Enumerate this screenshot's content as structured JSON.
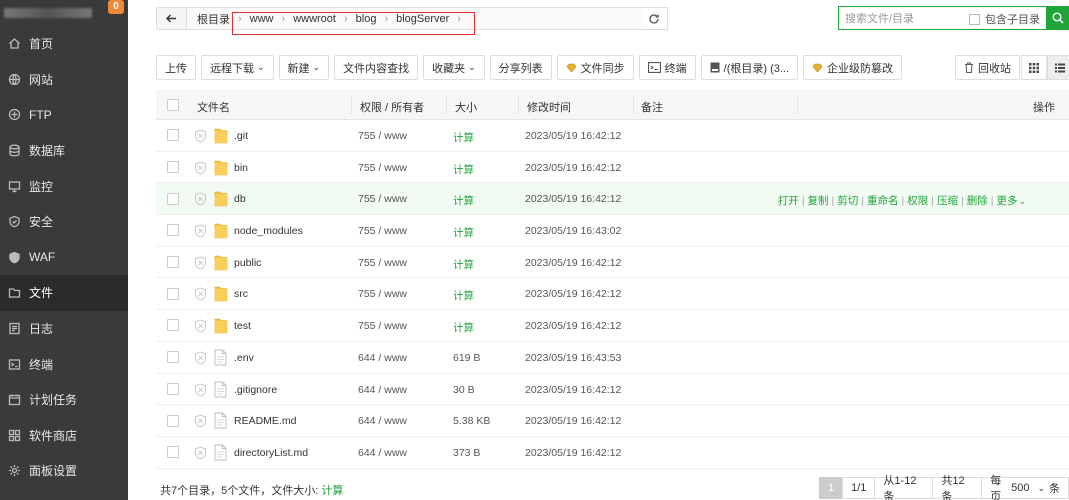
{
  "sidebar": {
    "badge": "0",
    "items": [
      {
        "label": "首页",
        "icon": "home-icon"
      },
      {
        "label": "网站",
        "icon": "globe-icon"
      },
      {
        "label": "FTP",
        "icon": "ftp-icon"
      },
      {
        "label": "数据库",
        "icon": "database-icon"
      },
      {
        "label": "监控",
        "icon": "monitor-icon"
      },
      {
        "label": "安全",
        "icon": "shield-icon"
      },
      {
        "label": "WAF",
        "icon": "waf-icon"
      },
      {
        "label": "文件",
        "icon": "folder-icon",
        "active": true
      },
      {
        "label": "日志",
        "icon": "log-icon"
      },
      {
        "label": "终端",
        "icon": "terminal-icon"
      },
      {
        "label": "计划任务",
        "icon": "calendar-icon"
      },
      {
        "label": "软件商店",
        "icon": "grid-icon"
      },
      {
        "label": "面板设置",
        "icon": "gear-icon"
      }
    ]
  },
  "path": {
    "crumbs": [
      "根目录",
      "www",
      "wwwroot",
      "blog",
      "blogServer"
    ]
  },
  "search": {
    "placeholder": "搜索文件/目录",
    "include_sub": "包含子目录"
  },
  "toolbar": {
    "upload": "上传",
    "remote_download": "远程下载",
    "new": "新建",
    "content_search": "文件内容查找",
    "favorites": "收藏夹",
    "share_list": "分享列表",
    "file_sync": "文件同步",
    "terminal": "终端",
    "disk": "/(根目录) (3...",
    "tamper": "企业级防篡改",
    "recycle": "回收站"
  },
  "table": {
    "headers": {
      "name": "文件名",
      "perm": "权限 / 所有者",
      "size": "大小",
      "mtime": "修改时间",
      "note": "备注",
      "ops": "操作"
    },
    "rows": [
      {
        "name": ".git",
        "type": "dir",
        "perm": "755 / www",
        "size": "计算",
        "mtime": "2023/05/19 16:42:12"
      },
      {
        "name": "bin",
        "type": "dir",
        "perm": "755 / www",
        "size": "计算",
        "mtime": "2023/05/19 16:42:12"
      },
      {
        "name": "db",
        "type": "dir",
        "perm": "755 / www",
        "size": "计算",
        "mtime": "2023/05/19 16:42:12",
        "hover": true
      },
      {
        "name": "node_modules",
        "type": "dir",
        "perm": "755 / www",
        "size": "计算",
        "mtime": "2023/05/19 16:43:02"
      },
      {
        "name": "public",
        "type": "dir",
        "perm": "755 / www",
        "size": "计算",
        "mtime": "2023/05/19 16:42:12"
      },
      {
        "name": "src",
        "type": "dir",
        "perm": "755 / www",
        "size": "计算",
        "mtime": "2023/05/19 16:42:12"
      },
      {
        "name": "test",
        "type": "dir",
        "perm": "755 / www",
        "size": "计算",
        "mtime": "2023/05/19 16:42:12"
      },
      {
        "name": ".env",
        "type": "file",
        "perm": "644 / www",
        "size": "619 B",
        "mtime": "2023/05/19 16:43:53"
      },
      {
        "name": ".gitignore",
        "type": "file",
        "perm": "644 / www",
        "size": "30 B",
        "mtime": "2023/05/19 16:42:12"
      },
      {
        "name": "README.md",
        "type": "file",
        "perm": "644 / www",
        "size": "5.38 KB",
        "mtime": "2023/05/19 16:42:12"
      },
      {
        "name": "directoryList.md",
        "type": "file",
        "perm": "644 / www",
        "size": "373 B",
        "mtime": "2023/05/19 16:42:12"
      }
    ],
    "row_ops": [
      "打开",
      "复制",
      "剪切",
      "重命名",
      "权限",
      "压缩",
      "删除",
      "更多"
    ]
  },
  "footer": {
    "summary_prefix": "共7个目录，5个文件，文件大小:",
    "summary_calc": "计算",
    "page_current": "1",
    "page_of": "1/1",
    "range": "从1-12条",
    "total": "共12条",
    "per_page_label": "每页",
    "per_page_value": "500",
    "per_page_unit": "条"
  },
  "colors": {
    "accent": "#20a53a",
    "sidebar_bg": "#3a3a3a",
    "badge": "#f0883a",
    "highlight_box": "#e03030"
  }
}
